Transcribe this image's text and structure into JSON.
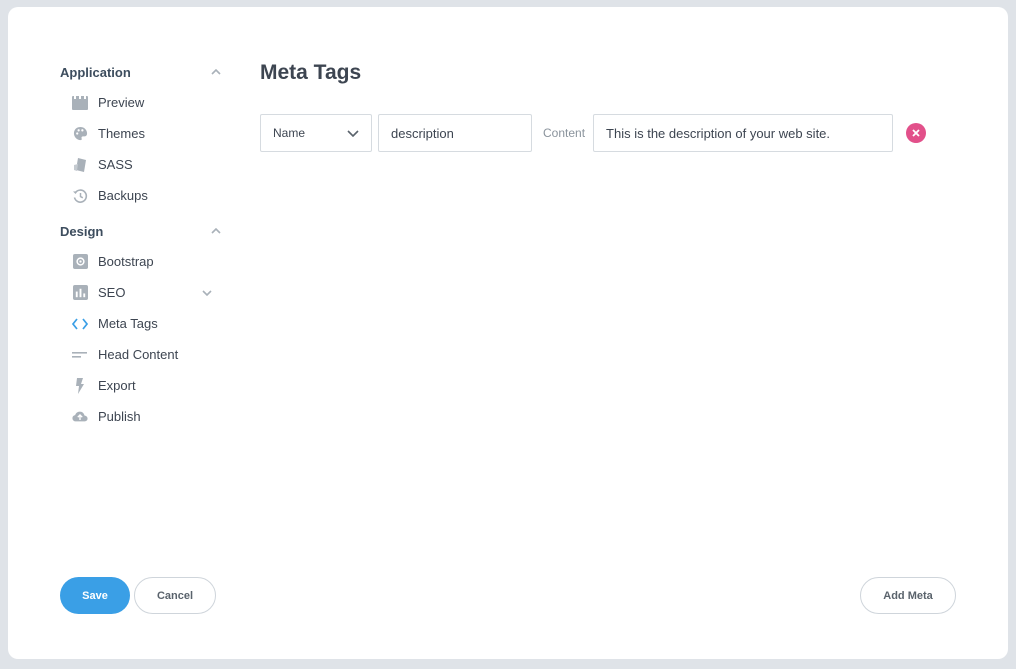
{
  "sidebar": {
    "sections": [
      {
        "title": "Application",
        "items": [
          {
            "label": "Preview",
            "icon": "film-icon"
          },
          {
            "label": "Themes",
            "icon": "palette-icon"
          },
          {
            "label": "SASS",
            "icon": "sass-icon"
          },
          {
            "label": "Backups",
            "icon": "restore-icon"
          }
        ]
      },
      {
        "title": "Design",
        "items": [
          {
            "label": "Bootstrap",
            "icon": "gear-icon"
          },
          {
            "label": "SEO",
            "icon": "bar-chart-icon"
          },
          {
            "label": "Meta Tags",
            "icon": "code-icon"
          },
          {
            "label": "Head Content",
            "icon": "lines-icon"
          },
          {
            "label": "Export",
            "icon": "lightning-icon"
          },
          {
            "label": "Publish",
            "icon": "cloud-upload-icon"
          }
        ]
      }
    ]
  },
  "main": {
    "title": "Meta Tags",
    "meta_row": {
      "type_select": "Name",
      "name_value": "description",
      "content_label": "Content",
      "content_value": "This is the description of your web site."
    }
  },
  "footer": {
    "save_label": "Save",
    "cancel_label": "Cancel",
    "add_meta_label": "Add Meta"
  },
  "colors": {
    "accent": "#3a9fe6",
    "remove": "#e2508a",
    "icon_gray": "#a9b1b9"
  }
}
